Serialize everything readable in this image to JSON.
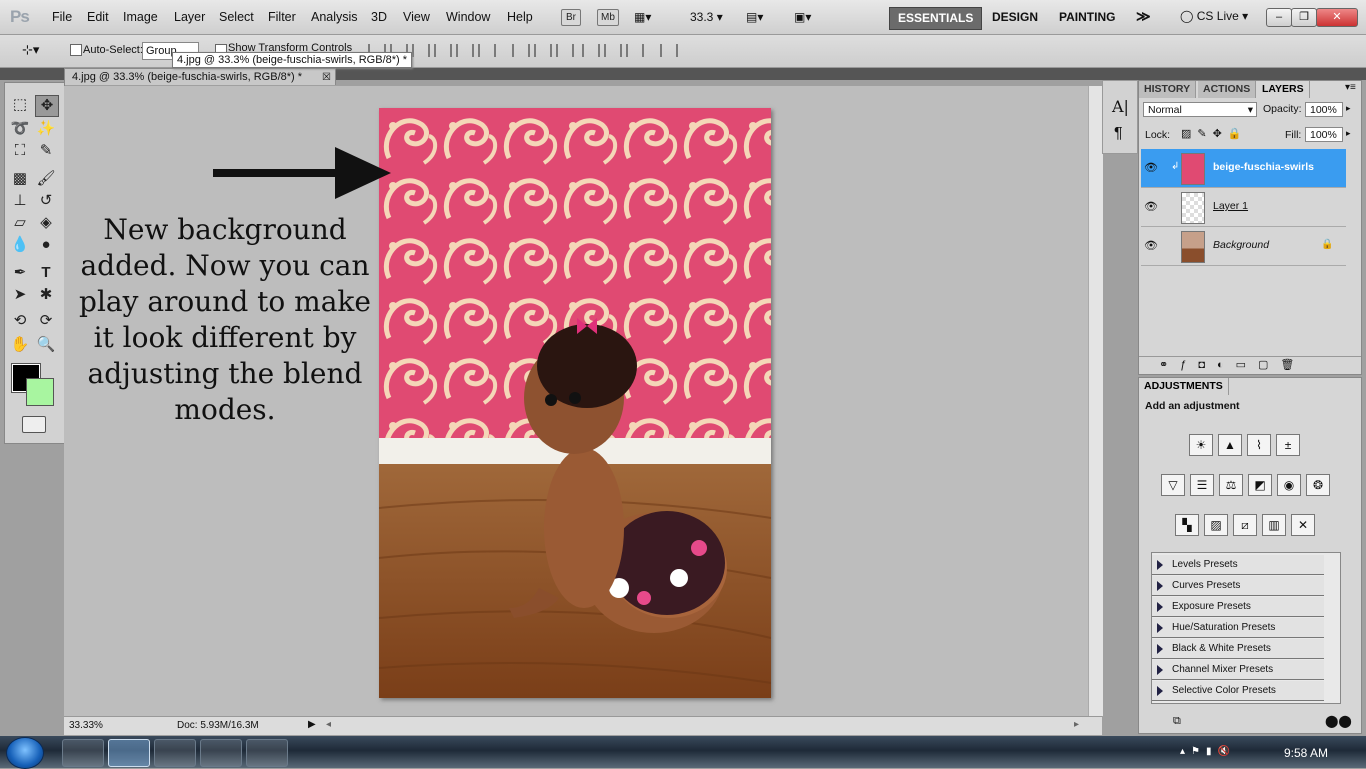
{
  "app": {
    "logo": "Ps"
  },
  "menu": [
    "File",
    "Edit",
    "Image",
    "Layer",
    "Select",
    "Filter",
    "Analysis",
    "3D",
    "View",
    "Window",
    "Help"
  ],
  "menubar_icons": {
    "bridge": "Br",
    "mini_bridge": "Mb"
  },
  "zoom_value": "33.3",
  "workspaces": [
    "ESSENTIALS",
    "DESIGN",
    "PAINTING"
  ],
  "cs_live": "CS Live",
  "options": {
    "auto_select": "Auto-Select:",
    "group_value": "Group",
    "show_transform": "Show Transform Controls"
  },
  "tooltip": "4.jpg @ 33.3% (beige-fuschia-swirls, RGB/8*) *",
  "document": {
    "tab_title": "4.jpg @ 33.3% (beige-fuschia-swirls, RGB/8*) *"
  },
  "status": {
    "zoom": "33.33%",
    "doc_size": "Doc: 5.93M/16.3M"
  },
  "annotation": [
    "New background",
    "added. Now you can",
    "play around to make",
    "it look different by",
    "adjusting the blend",
    "modes."
  ],
  "layers_panel": {
    "tabs": [
      "HISTORY",
      "ACTIONS",
      "LAYERS"
    ],
    "blend_mode": "Normal",
    "opacity_label": "Opacity:",
    "opacity_value": "100%",
    "lock_label": "Lock:",
    "fill_label": "Fill:",
    "fill_value": "100%",
    "layers": [
      {
        "name": "beige-fuschia-swirls"
      },
      {
        "name": "Layer 1"
      },
      {
        "name": "Background"
      }
    ]
  },
  "adjustments": {
    "tab": "ADJUSTMENTS",
    "heading": "Add an adjustment",
    "presets": [
      "Levels Presets",
      "Curves Presets",
      "Exposure Presets",
      "Hue/Saturation Presets",
      "Black & White Presets",
      "Channel Mixer Presets",
      "Selective Color Presets"
    ]
  },
  "taskbar": {
    "clock": "9:58 AM"
  },
  "colors": {
    "foreground": "#000000",
    "background": "#a8f5a0",
    "selected_layer": "#3a9cf0",
    "wallpaper_pink": "#e04a72"
  }
}
